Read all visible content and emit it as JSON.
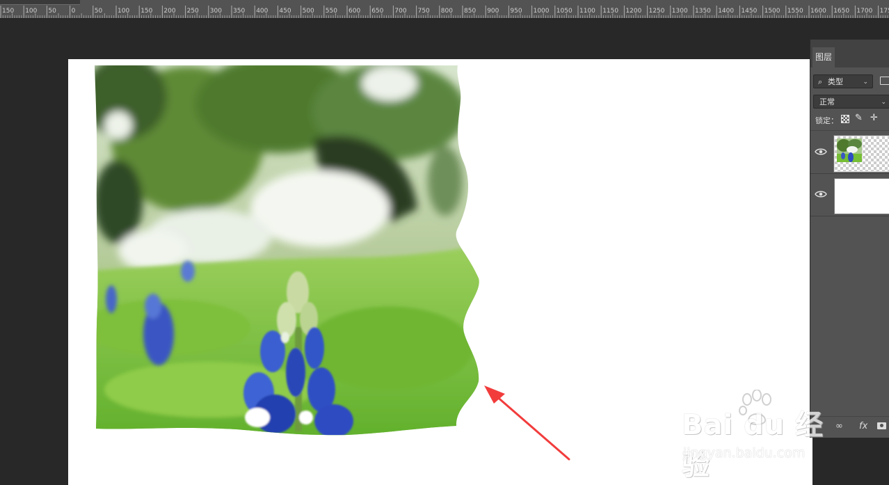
{
  "ruler": {
    "labels": [
      "150",
      "100",
      "50",
      "0",
      "50",
      "100",
      "150",
      "200",
      "250",
      "300",
      "350",
      "400",
      "450",
      "500",
      "550",
      "600",
      "650",
      "700",
      "750",
      "800",
      "850",
      "900",
      "950",
      "1000",
      "1050",
      "1100",
      "1150",
      "1200",
      "1250",
      "1300",
      "1350",
      "1400",
      "1450",
      "1500",
      "1550",
      "1600",
      "1650",
      "1700",
      "1750"
    ],
    "unit_pixels_per_50": 33.2,
    "zero_x_offset_units": 150
  },
  "layers_panel": {
    "tab_label": "图层",
    "filter": {
      "icon": "search-icon",
      "label": "类型"
    },
    "blend_mode": "正常",
    "lock_label": "锁定：",
    "lock_icons": [
      "checkerboard-lock-icon",
      "brush-lock-icon",
      "move-lock-icon"
    ],
    "layers": [
      {
        "visible": true,
        "thumbnail": "flower-image-transparent",
        "selected": true
      },
      {
        "visible": true,
        "thumbnail": "white-background",
        "selected": false
      }
    ],
    "footer_icons": [
      "link-icon",
      "fx-icon",
      "mask-icon"
    ],
    "footer_fx_label": "fx"
  },
  "annotation": {
    "arrow_color": "#f23c3c"
  },
  "watermark": {
    "brand": "Bai du 经验",
    "url": "jingyan.baidu.com"
  },
  "colors": {
    "workspace": "#282828",
    "panel": "#535353",
    "ruler": "#535353",
    "document": "#ffffff"
  }
}
